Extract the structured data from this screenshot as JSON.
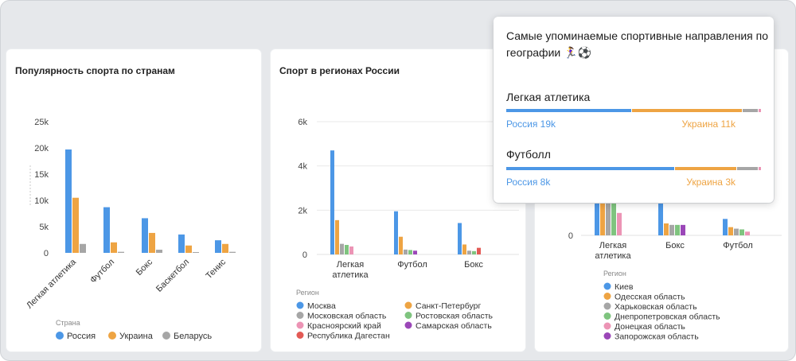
{
  "colors": {
    "blue": "#4c97e6",
    "orange": "#eea443",
    "gray": "#a6a6a6",
    "green": "#7fc47f",
    "pink": "#ec94b5",
    "purple": "#9b47b8",
    "red": "#e35a55"
  },
  "chart_data": [
    {
      "type": "bar",
      "title": "Популярность спорта по странам",
      "categories": [
        "Легкая атлетика",
        "Футбол",
        "Бокс",
        "Баскетбол",
        "Тенис"
      ],
      "y_ticks": [
        "0",
        "5k",
        "10k",
        "15k",
        "20k",
        "25k"
      ],
      "ylim": [
        0,
        25000
      ],
      "legend_title": "Страна",
      "series": [
        {
          "name": "Россия",
          "color": "#4c97e6",
          "values": [
            19700,
            8700,
            6600,
            3500,
            2400
          ]
        },
        {
          "name": "Украина",
          "color": "#eea443",
          "values": [
            10500,
            2000,
            3800,
            1400,
            1700
          ]
        },
        {
          "name": "Беларусь",
          "color": "#a6a6a6",
          "values": [
            1700,
            200,
            600,
            100,
            200
          ]
        }
      ]
    },
    {
      "type": "bar",
      "title": "Спорт в регионах России",
      "categories": [
        "Легкая атлетика",
        "Футбол",
        "Бокс"
      ],
      "y_ticks": [
        "0",
        "2k",
        "4k",
        "6k"
      ],
      "ylim": [
        0,
        6000
      ],
      "legend_title": "Регион",
      "series": [
        {
          "name": "Москва",
          "color": "#4c97e6",
          "values": [
            4700,
            1950,
            1420
          ]
        },
        {
          "name": "Санкт-Петербург",
          "color": "#eea443",
          "values": [
            1550,
            800,
            450
          ]
        },
        {
          "name": "Московская область",
          "color": "#a6a6a6",
          "values": [
            480,
            220,
            170
          ]
        },
        {
          "name": "Ростовская область",
          "color": "#7fc47f",
          "values": [
            430,
            200,
            150
          ]
        },
        {
          "name": "Красноярский край",
          "color": "#ec94b5",
          "values": [
            360,
            0,
            0
          ]
        },
        {
          "name": "Самарская область",
          "color": "#9b47b8",
          "values": [
            0,
            170,
            0
          ]
        },
        {
          "name": "Республика Дагестан",
          "color": "#e35a55",
          "values": [
            0,
            0,
            300
          ]
        }
      ]
    },
    {
      "type": "bar",
      "title": "",
      "categories": [
        "Легкая атлетика",
        "Бокс",
        "Футбол"
      ],
      "y_ticks": [
        "0"
      ],
      "legend_title": "Регион",
      "series": [
        {
          "name": "Киев",
          "color": "#4c97e6",
          "values": [
            2500,
            2200,
            1100
          ]
        },
        {
          "name": "Одесская область",
          "color": "#eea443",
          "values": [
            2500,
            800,
            550
          ]
        },
        {
          "name": "Харьковская область",
          "color": "#a6a6a6",
          "values": [
            2500,
            700,
            450
          ]
        },
        {
          "name": "Днепропетровская область",
          "color": "#7fc47f",
          "values": [
            2500,
            700,
            400
          ]
        },
        {
          "name": "Донецкая область",
          "color": "#ec94b5",
          "values": [
            1500,
            0,
            250
          ]
        },
        {
          "name": "Запорожская область",
          "color": "#9b47b8",
          "values": [
            0,
            700,
            0
          ]
        }
      ]
    }
  ],
  "tooltip": {
    "title": "Самые упоминаемые спортивные направления по географии 🏃‍♀️⚽",
    "items": [
      {
        "sport": "Легкая атлетика",
        "left_label": "Россия 19k",
        "right_label": "Украина 11k",
        "shares": [
          0.496,
          0.434,
          0.062,
          0.008
        ]
      },
      {
        "sport": "Футболл",
        "left_label": "Россия 8k",
        "right_label": "Украина 3k",
        "shares": [
          0.665,
          0.245,
          0.08,
          0.01
        ]
      }
    ]
  }
}
